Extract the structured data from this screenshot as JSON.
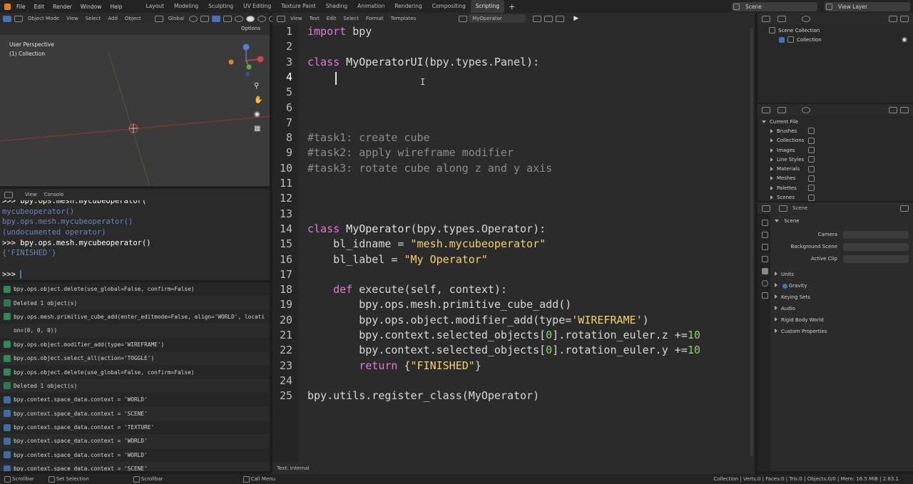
{
  "topbar": {
    "menus": [
      "File",
      "Edit",
      "Render",
      "Window",
      "Help"
    ],
    "workspaces": [
      "Layout",
      "Modeling",
      "Sculpting",
      "UV Editing",
      "Texture Paint",
      "Shading",
      "Animation",
      "Rendering",
      "Compositing",
      "Scripting"
    ],
    "active_workspace": "Scripting",
    "scene": "Scene",
    "view_layer": "View Layer"
  },
  "viewport": {
    "mode": "Object Mode",
    "menus": [
      "View",
      "Select",
      "Add",
      "Object"
    ],
    "orientation": "Global",
    "options": "Options",
    "perspective": "User Perspective",
    "collection": "(1) Collection"
  },
  "console": {
    "menus": [
      "View",
      "Console"
    ],
    "lines": [
      {
        "text": ">>> bpy.ops.mesh.mycubeoperator(",
        "color": "white"
      },
      {
        "text": "mycubeoperator()",
        "color": "blue"
      },
      {
        "text": "bpy.ops.mesh.mycubeoperator()",
        "color": "blue"
      },
      {
        "text": "(undocumented operator)",
        "color": "blue"
      },
      {
        "text": ">>> bpy.ops.mesh.mycubeoperator()",
        "color": "white"
      },
      {
        "text": "{'FINISHED'}",
        "color": "blue"
      },
      {
        "text": "",
        "color": "white"
      },
      {
        "text": ">>> ",
        "color": "white"
      }
    ]
  },
  "info": {
    "rows": [
      {
        "kind": "check",
        "text": "bpy.ops.object.delete(use_global=False, confirm=False)"
      },
      {
        "kind": "report",
        "text": "Deleted 1 object(s)"
      },
      {
        "kind": "check",
        "text": "bpy.ops.mesh.primitive_cube_add(enter_editmode=False, align='WORLD', locati"
      },
      {
        "kind": "none",
        "text": "on=(0, 0, 0))"
      },
      {
        "kind": "check",
        "text": "bpy.ops.object.modifier_add(type='WIREFRAME')"
      },
      {
        "kind": "check",
        "text": "bpy.ops.object.select_all(action='TOGGLE')"
      },
      {
        "kind": "check",
        "text": "bpy.ops.object.delete(use_global=False, confirm=False)"
      },
      {
        "kind": "report",
        "text": "Deleted 1 object(s)"
      },
      {
        "kind": "prop",
        "text": "bpy.context.space_data.context = 'WORLD'"
      },
      {
        "kind": "prop",
        "text": "bpy.context.space_data.context = 'SCENE'"
      },
      {
        "kind": "prop",
        "text": "bpy.context.space_data.context = 'TEXTURE'"
      },
      {
        "kind": "prop",
        "text": "bpy.context.space_data.context = 'WORLD'"
      },
      {
        "kind": "prop",
        "text": "bpy.context.space_data.context = 'WORLD'"
      },
      {
        "kind": "prop",
        "text": "bpy.context.space_data.context = 'SCENE'"
      }
    ]
  },
  "editor": {
    "menus": [
      "View",
      "Text",
      "Edit",
      "Select",
      "Format",
      "Templates"
    ],
    "filename": "MyOperator",
    "footer": "Text: Internal",
    "current_line": 4,
    "lines": [
      [
        [
          "import",
          "kw"
        ],
        [
          " bpy",
          "p"
        ]
      ],
      [],
      [
        [
          "class",
          "kw"
        ],
        [
          " MyOperatorUI",
          "cls"
        ],
        [
          "(bpy.types.Panel):",
          "p"
        ]
      ],
      [
        [
          "    ",
          "p"
        ]
      ],
      [],
      [],
      [],
      [
        [
          "#task1: create cube",
          "cmt"
        ]
      ],
      [
        [
          "#task2: apply wireframe modifier",
          "cmt"
        ]
      ],
      [
        [
          "#task3: rotate cube along z and y axis",
          "cmt"
        ]
      ],
      [],
      [],
      [],
      [
        [
          "class",
          "kw"
        ],
        [
          " MyOperator",
          "cls"
        ],
        [
          "(bpy.types.Operator):",
          "p"
        ]
      ],
      [
        [
          "    bl_idname = ",
          "p"
        ],
        [
          "\"mesh.mycubeoperator\"",
          "str"
        ]
      ],
      [
        [
          "    bl_label = ",
          "p"
        ],
        [
          "\"My Operator\"",
          "str"
        ]
      ],
      [],
      [
        [
          "    ",
          "p"
        ],
        [
          "def",
          "kw"
        ],
        [
          " execute(self, context):",
          "p"
        ]
      ],
      [
        [
          "        bpy.ops.mesh.primitive_cube_add()",
          "p"
        ]
      ],
      [
        [
          "        bpy.ops.object.modifier_add(type=",
          "p"
        ],
        [
          "'WIREFRAME'",
          "str"
        ],
        [
          ")",
          "p"
        ]
      ],
      [
        [
          "        bpy.context.selected_objects[",
          "p"
        ],
        [
          "0",
          "num"
        ],
        [
          "].rotation_euler.z +=",
          "p"
        ],
        [
          "10",
          "num"
        ]
      ],
      [
        [
          "        bpy.context.selected_objects[",
          "p"
        ],
        [
          "0",
          "num"
        ],
        [
          "].rotation_euler.y +=",
          "p"
        ],
        [
          "10",
          "num"
        ]
      ],
      [
        [
          "        ",
          "p"
        ],
        [
          "return",
          "kw"
        ],
        [
          " {",
          "p"
        ],
        [
          "\"FINISHED\"",
          "str"
        ],
        [
          "}",
          "p"
        ]
      ],
      [],
      [
        [
          "bpy.utils.register_class(MyOperator)",
          "p"
        ]
      ]
    ]
  },
  "outliner": {
    "scene_collection": "Scene Collection",
    "collection": "Collection"
  },
  "file_browser": {
    "root": "Current File",
    "items": [
      "Brushes",
      "Collections",
      "Images",
      "Line Styles",
      "Materials",
      "Meshes",
      "Palettes",
      "Scenes"
    ]
  },
  "properties": {
    "header": "Scene",
    "panel": "Scene",
    "fields": [
      "Camera",
      "Background Scene",
      "Active Clip"
    ],
    "sections": [
      "Units",
      "Gravity",
      "Keying Sets",
      "Audio",
      "Rigid Body World",
      "Custom Properties"
    ]
  },
  "statusbar": {
    "items": [
      "Scrollbar",
      "Set Selection",
      "Scrollbar",
      "Call Menu"
    ],
    "stats": "Collection | Verts:0 | Faces:0 | Tris:0 | Objects:0/0 | Mem: 16.5 MiB | 2.83.1"
  }
}
